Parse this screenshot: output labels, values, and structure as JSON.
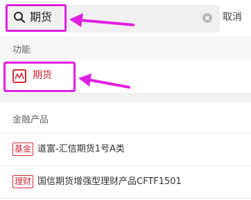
{
  "search": {
    "query": "期货",
    "cancel_label": "取消"
  },
  "sections": {
    "function": {
      "label": "功能",
      "items": [
        {
          "label": "期货"
        }
      ]
    },
    "financial": {
      "label": "金融产品",
      "items": [
        {
          "tag": "基金",
          "name": "道富-汇信期货1号A类"
        },
        {
          "tag": "理财",
          "name": "国信期货增强型理财产品CFTF1501"
        }
      ]
    }
  },
  "colors": {
    "accent": "#d7263a",
    "annotation": "#e020e0"
  }
}
